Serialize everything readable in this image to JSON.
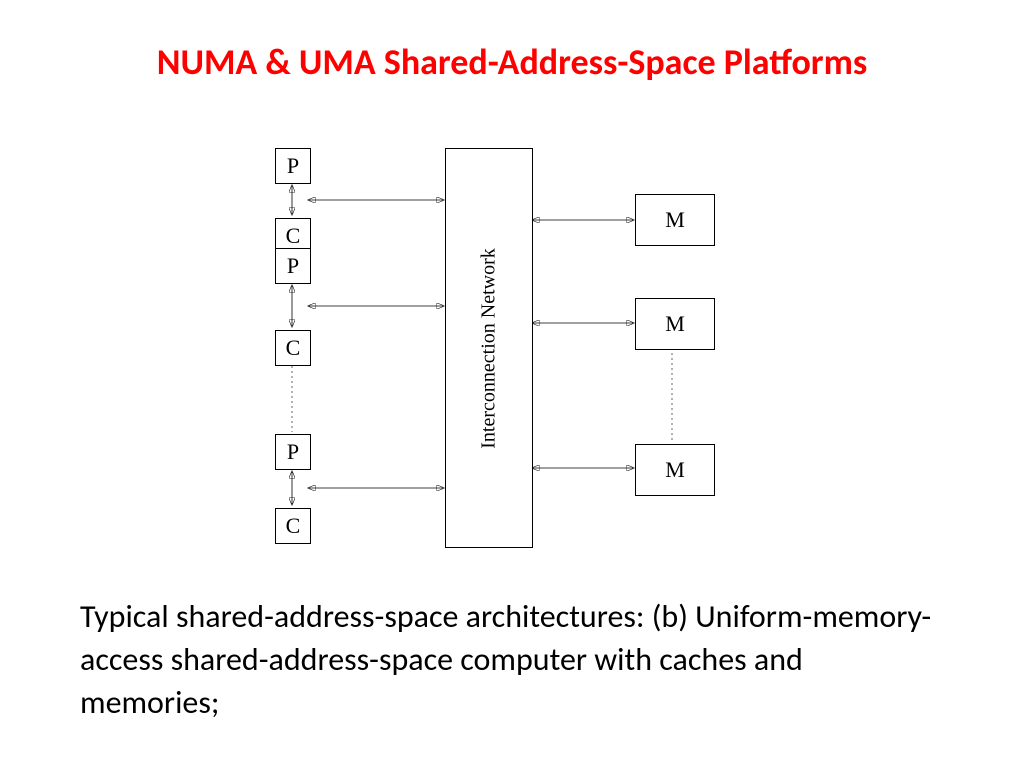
{
  "title": "NUMA & UMA Shared-Address-Space Platforms",
  "diagram": {
    "processor_label": "P",
    "cache_label": "C",
    "memory_label": "M",
    "network_label": "Interconnection Network"
  },
  "caption": "Typical shared-address-space architectures:  (b) Uniform-memory-access shared-address-space computer with  caches and memories;"
}
